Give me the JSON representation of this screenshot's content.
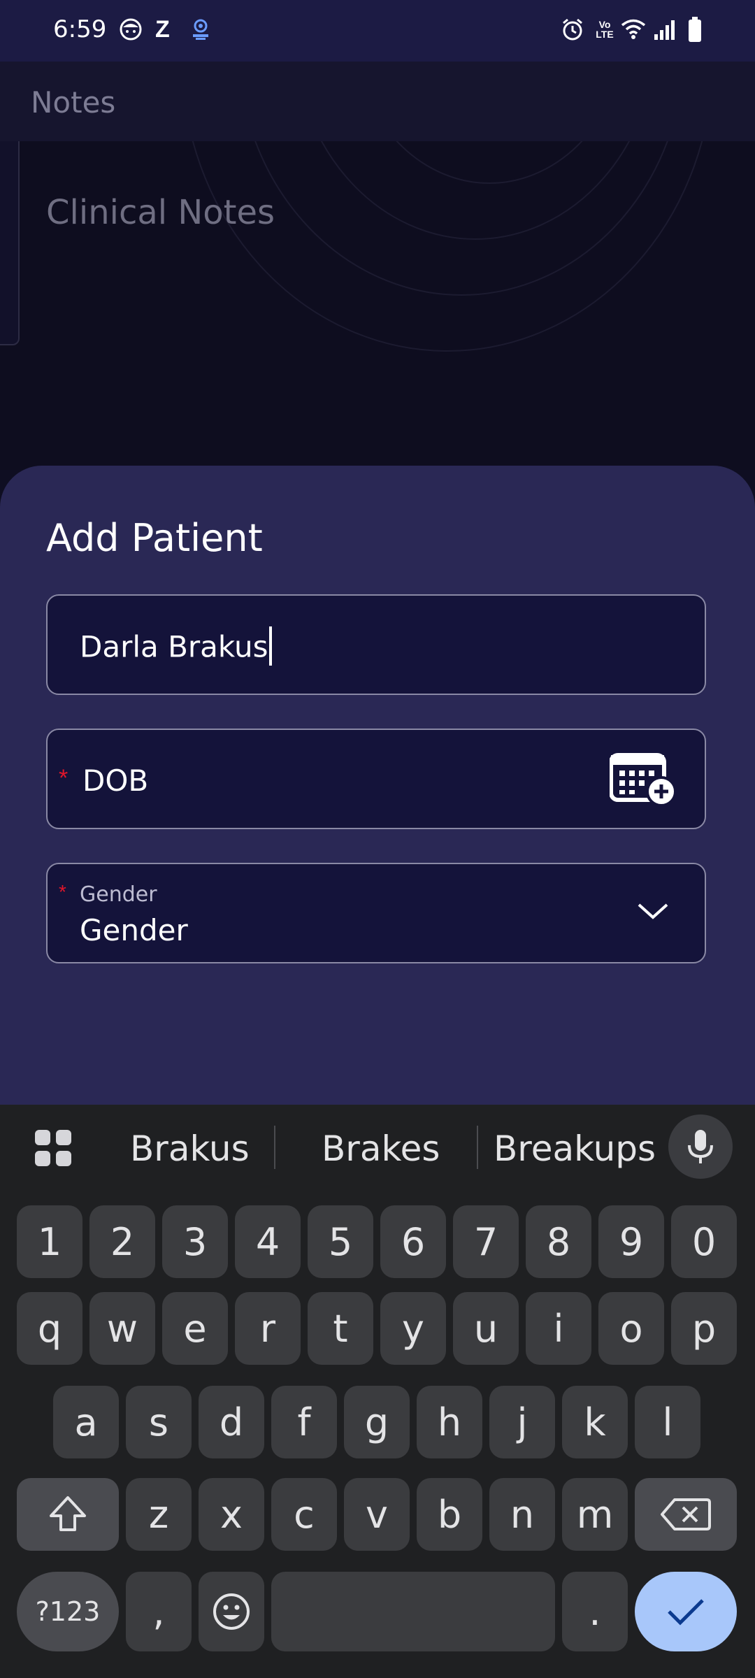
{
  "status_bar": {
    "time": "6:59",
    "left_icons": [
      "face-icon",
      "z-app-icon",
      "accessibility-icon"
    ],
    "right_icons": [
      "alarm-icon",
      "volte-icon",
      "wifi-icon",
      "signal-icon",
      "battery-icon"
    ],
    "volte_text": "Vo LTE"
  },
  "background_app": {
    "header_title": "Notes",
    "section_title": "Clinical Notes"
  },
  "sheet": {
    "title": "Add Patient",
    "name_field": {
      "value": "Darla Brakus"
    },
    "dob_field": {
      "required_mark": "*",
      "label": "DOB",
      "icon": "calendar-add-icon"
    },
    "gender_field": {
      "required_mark": "*",
      "label": "Gender",
      "value": "Gender",
      "icon": "chevron-down-icon"
    }
  },
  "keyboard": {
    "suggestions": [
      "Brakus",
      "Brakes",
      "Breakups"
    ],
    "number_row": [
      "1",
      "2",
      "3",
      "4",
      "5",
      "6",
      "7",
      "8",
      "9",
      "0"
    ],
    "row1": [
      "q",
      "w",
      "e",
      "r",
      "t",
      "y",
      "u",
      "i",
      "o",
      "p"
    ],
    "row2": [
      "a",
      "s",
      "d",
      "f",
      "g",
      "h",
      "j",
      "k",
      "l"
    ],
    "row3": [
      "z",
      "x",
      "c",
      "v",
      "b",
      "n",
      "m"
    ],
    "symbols_key": "?123",
    "comma_key": ",",
    "period_key": ".",
    "colors": {
      "enter": "#a8c7fa",
      "key": "#3b3c3f",
      "background": "#1f2022"
    }
  },
  "colors": {
    "sheet": "#2a2855",
    "field": "#14133a",
    "required": "#e0162b",
    "status_bar": "#1c1b44"
  }
}
